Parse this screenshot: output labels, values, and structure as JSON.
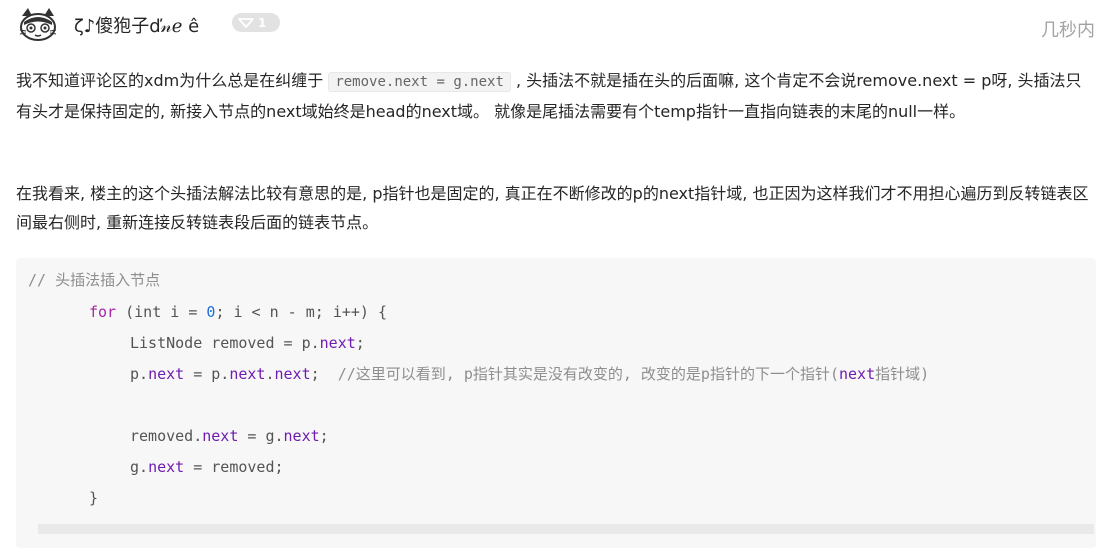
{
  "comment": {
    "username": "ζ♪傻狍子ď𝓃ℯ ê",
    "like_count": "1",
    "time": "几秒内",
    "paragraph1_pre": "我不知道评论区的xdm为什么总是在纠缠于",
    "paragraph1_code": "remove.next = g.next",
    "paragraph1_post": ", 头插法不就是插在头的后面嘛, 这个肯定不会说remove.next = p呀, 头插法只有头才是保持固定的, 新接入节点的next域始终是head的next域。 就像是尾插法需要有个temp指针一直指向链表的末尾的null一样。",
    "paragraph2": "在我看来, 楼主的这个头插法解法比较有意思的是, p指针也是固定的, 真正在不断修改的p的next指针域, 也正因为这样我们才不用担心遍历到反转链表区间最右侧时, 重新连接反转链表段后面的链表节点。"
  },
  "code": {
    "line1": "// 头插法插入节点",
    "line2_kw": "for",
    "line2_a": " (int i = ",
    "line2_num": "0",
    "line2_b": "; i < n - m; i++) {",
    "line3_a": "ListNode removed = p.",
    "line3_prop": "next",
    "line3_b": ";",
    "line4_a": "p.",
    "line4_prop1": "next",
    "line4_b": " = p.",
    "line4_prop2": "next",
    "line4_c": ".",
    "line4_prop3": "next",
    "line4_d": ";  ",
    "line4_comment_a": "//这里可以看到, p指针其实是没有改变的, 改变的是p指针的下一个指针(",
    "line4_comment_prop": "next",
    "line4_comment_b": "指针域)",
    "line6_a": "removed.",
    "line6_prop1": "next",
    "line6_b": " = g.",
    "line6_prop2": "next",
    "line6_c": ";",
    "line7_a": "g.",
    "line7_prop": "next",
    "line7_b": " = removed;",
    "line8": "}"
  },
  "colors": {
    "keyword": "#a626a4",
    "number": "#1e6fd9",
    "property": "#6f1cb0",
    "comment": "#8e8e8e"
  },
  "icons": [
    "avatar-cat-icon",
    "thumbs-up-icon"
  ]
}
